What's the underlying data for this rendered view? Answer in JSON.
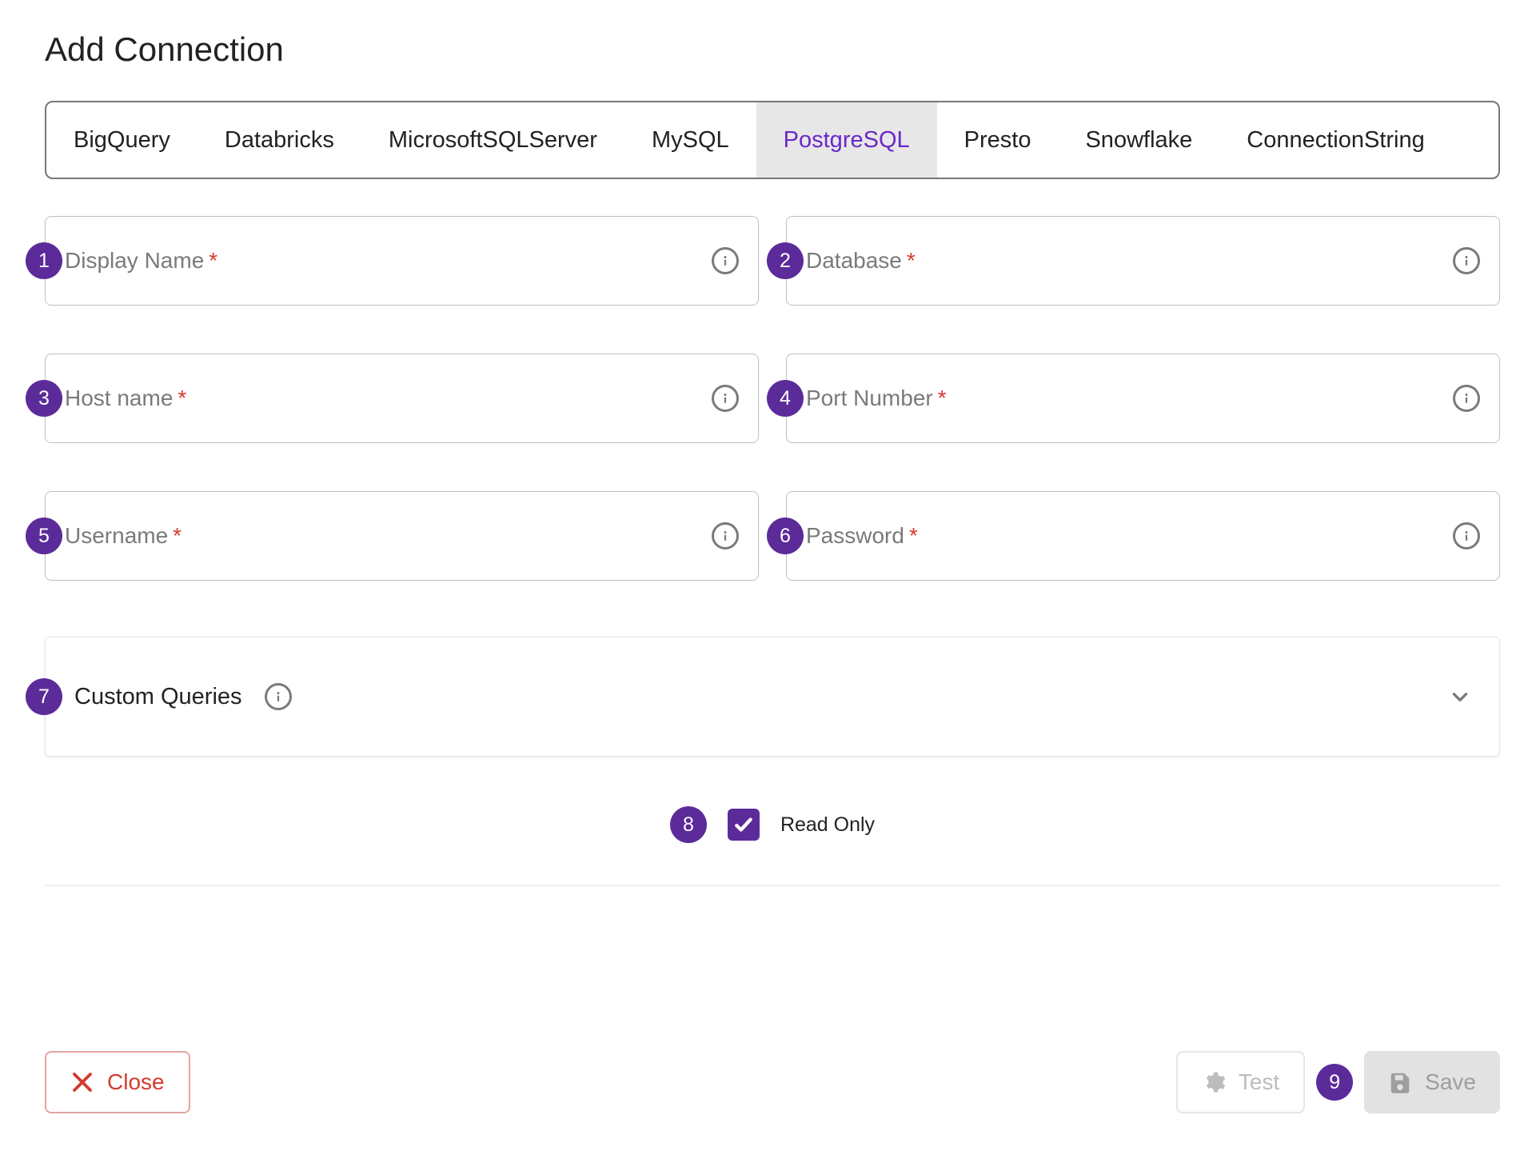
{
  "title": "Add Connection",
  "tabs": [
    {
      "label": "BigQuery"
    },
    {
      "label": "Databricks"
    },
    {
      "label": "MicrosoftSQLServer"
    },
    {
      "label": "MySQL"
    },
    {
      "label": "PostgreSQL"
    },
    {
      "label": "Presto"
    },
    {
      "label": "Snowflake"
    },
    {
      "label": "ConnectionString"
    }
  ],
  "active_tab": "PostgreSQL",
  "fields": {
    "display_name": {
      "label": "Display Name",
      "required": true,
      "badge": "1"
    },
    "database": {
      "label": "Database",
      "required": true,
      "badge": "2"
    },
    "host": {
      "label": "Host name",
      "required": true,
      "badge": "3"
    },
    "port": {
      "label": "Port Number",
      "required": true,
      "badge": "4"
    },
    "username": {
      "label": "Username",
      "required": true,
      "badge": "5"
    },
    "password": {
      "label": "Password",
      "required": true,
      "badge": "6"
    }
  },
  "custom_queries": {
    "label": "Custom Queries",
    "badge": "7"
  },
  "readonly": {
    "label": "Read Only",
    "checked": true,
    "badge": "8"
  },
  "required_marker": "*",
  "buttons": {
    "close": "Close",
    "test": "Test",
    "save": "Save",
    "save_badge": "9"
  }
}
